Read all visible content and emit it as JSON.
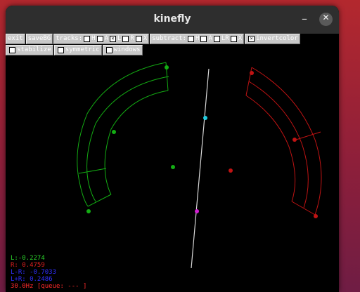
{
  "window": {
    "title": "kinefly"
  },
  "titlebar": {
    "minimize_glyph": "–",
    "close_glyph": "✕"
  },
  "toolbar": {
    "exit_label": "exit",
    "save_label": "saveBG",
    "tracks_label": "tracks:",
    "tracks": [
      {
        "label": "H",
        "checked": false
      },
      {
        "label": "A",
        "checked": false
      },
      {
        "label": "L",
        "checked": true
      },
      {
        "label": "R",
        "checked": false
      },
      {
        "label": "X",
        "checked": false
      }
    ],
    "subtract_label": "subtract:",
    "subtract": [
      {
        "label": "H",
        "checked": false
      },
      {
        "label": "A",
        "checked": false
      },
      {
        "label": "LR",
        "checked": false
      },
      {
        "label": "X",
        "checked": false
      }
    ],
    "invert_label": "invertcolor",
    "invert_checked": true,
    "stabilize_label": "stabilize",
    "stabilize_checked": false,
    "symmetric_label": "symmetric",
    "symmetric_checked": false,
    "windows_label": "windows",
    "windows_checked": false
  },
  "status": {
    "left": "L:-0.2274",
    "right": "R: 0.4759",
    "diff": "L-R: -0.7033",
    "sum": "L+R: 0.2486",
    "rate": "30.0Hz [queue: ---      ]"
  },
  "colors": {
    "left_wing": "#13ad13",
    "right_wing": "#c01313",
    "body_axis": "#d9d9d9",
    "head_point": "#22cde0",
    "abdomen_point": "#d11fd1",
    "status_left": "#2bd12b",
    "status_right": "#e02020",
    "status_diff": "#3030ff",
    "status_sum": "#3030ff",
    "status_rate": "#ff2a2a"
  }
}
